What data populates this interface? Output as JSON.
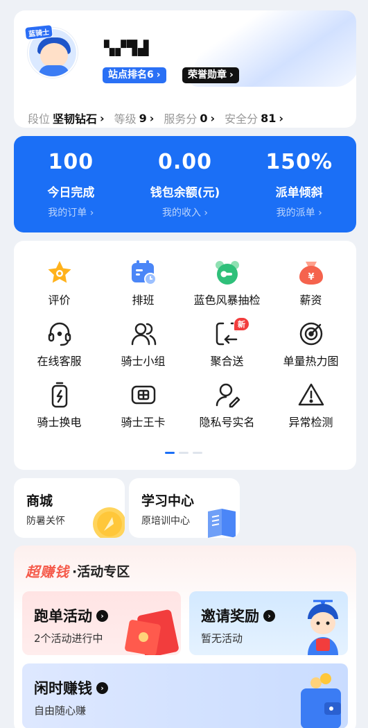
{
  "profile": {
    "avatar_badge": "蓝骑士",
    "name": "▚▞▜▟",
    "rank_tag": "站点排名6",
    "honor_tag": "荣誉勋章",
    "stats": [
      {
        "key": "段位",
        "value": "坚韧钻石"
      },
      {
        "key": "等级",
        "value": "9"
      },
      {
        "key": "服务分",
        "value": "0"
      },
      {
        "key": "安全分",
        "value": "81"
      }
    ]
  },
  "summary": [
    {
      "value": "100",
      "label": "今日完成",
      "link": "我的订单"
    },
    {
      "value": "0.00",
      "label": "钱包余额(元)",
      "link": "我的收入"
    },
    {
      "value": "150%",
      "label": "派单倾斜",
      "link": "我的派单"
    }
  ],
  "grid": [
    {
      "label": "评价",
      "icon": "star-icon"
    },
    {
      "label": "排班",
      "icon": "calendar-icon"
    },
    {
      "label": "蓝色风暴抽检",
      "icon": "alarm-clock-icon"
    },
    {
      "label": "薪资",
      "icon": "money-bag-icon"
    },
    {
      "label": "在线客服",
      "icon": "headset-icon"
    },
    {
      "label": "骑士小组",
      "icon": "group-icon"
    },
    {
      "label": "聚合送",
      "icon": "route-icon",
      "badge": "新"
    },
    {
      "label": "单量热力图",
      "icon": "target-icon"
    },
    {
      "label": "骑士换电",
      "icon": "battery-icon"
    },
    {
      "label": "骑士王卡",
      "icon": "sim-card-icon"
    },
    {
      "label": "隐私号实名",
      "icon": "user-verify-icon"
    },
    {
      "label": "异常检测",
      "icon": "warning-icon"
    }
  ],
  "mini_cards": {
    "shop": {
      "title": "商城",
      "sub": "防暑关怀"
    },
    "study": {
      "title": "学习中心",
      "sub": "原培训中心"
    }
  },
  "activity": {
    "brand": "超赚钱",
    "zone": "·活动专区",
    "run": {
      "title": "跑单活动",
      "sub": "2个活动进行中"
    },
    "invite": {
      "title": "邀请奖励",
      "sub": "暂无活动"
    },
    "idle": {
      "title": "闲时赚钱",
      "sub": "自由随心赚"
    }
  },
  "colors": {
    "primary": "#1b6ff6",
    "accent_red": "#f55a4a",
    "badge_red": "#f23d3d"
  }
}
